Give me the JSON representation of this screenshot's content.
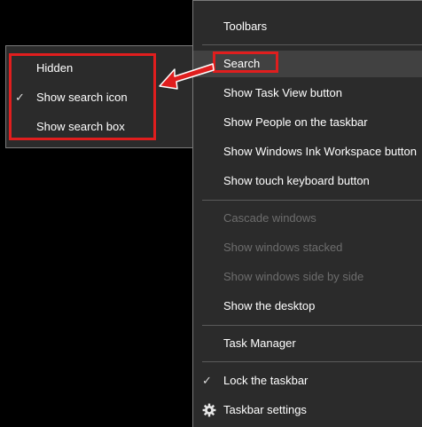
{
  "taskbar_menu": {
    "items": [
      {
        "label": "Toolbars"
      },
      {
        "label": "Search"
      },
      {
        "label": "Show Task View button"
      },
      {
        "label": "Show People on the taskbar"
      },
      {
        "label": "Show Windows Ink Workspace button"
      },
      {
        "label": "Show touch keyboard button"
      },
      {
        "label": "Cascade windows"
      },
      {
        "label": "Show windows stacked"
      },
      {
        "label": "Show windows side by side"
      },
      {
        "label": "Show the desktop"
      },
      {
        "label": "Task Manager"
      },
      {
        "label": "Lock the taskbar"
      },
      {
        "label": "Taskbar settings"
      }
    ]
  },
  "search_submenu": {
    "items": [
      {
        "label": "Hidden"
      },
      {
        "label": "Show search icon"
      },
      {
        "label": "Show search box"
      }
    ]
  },
  "check_glyph": "✓",
  "colors": {
    "menu_bg": "#2b2b2b",
    "highlight_bg": "#414141",
    "disabled_text": "#6d6d6d",
    "annotation_red": "#e01e1e"
  }
}
